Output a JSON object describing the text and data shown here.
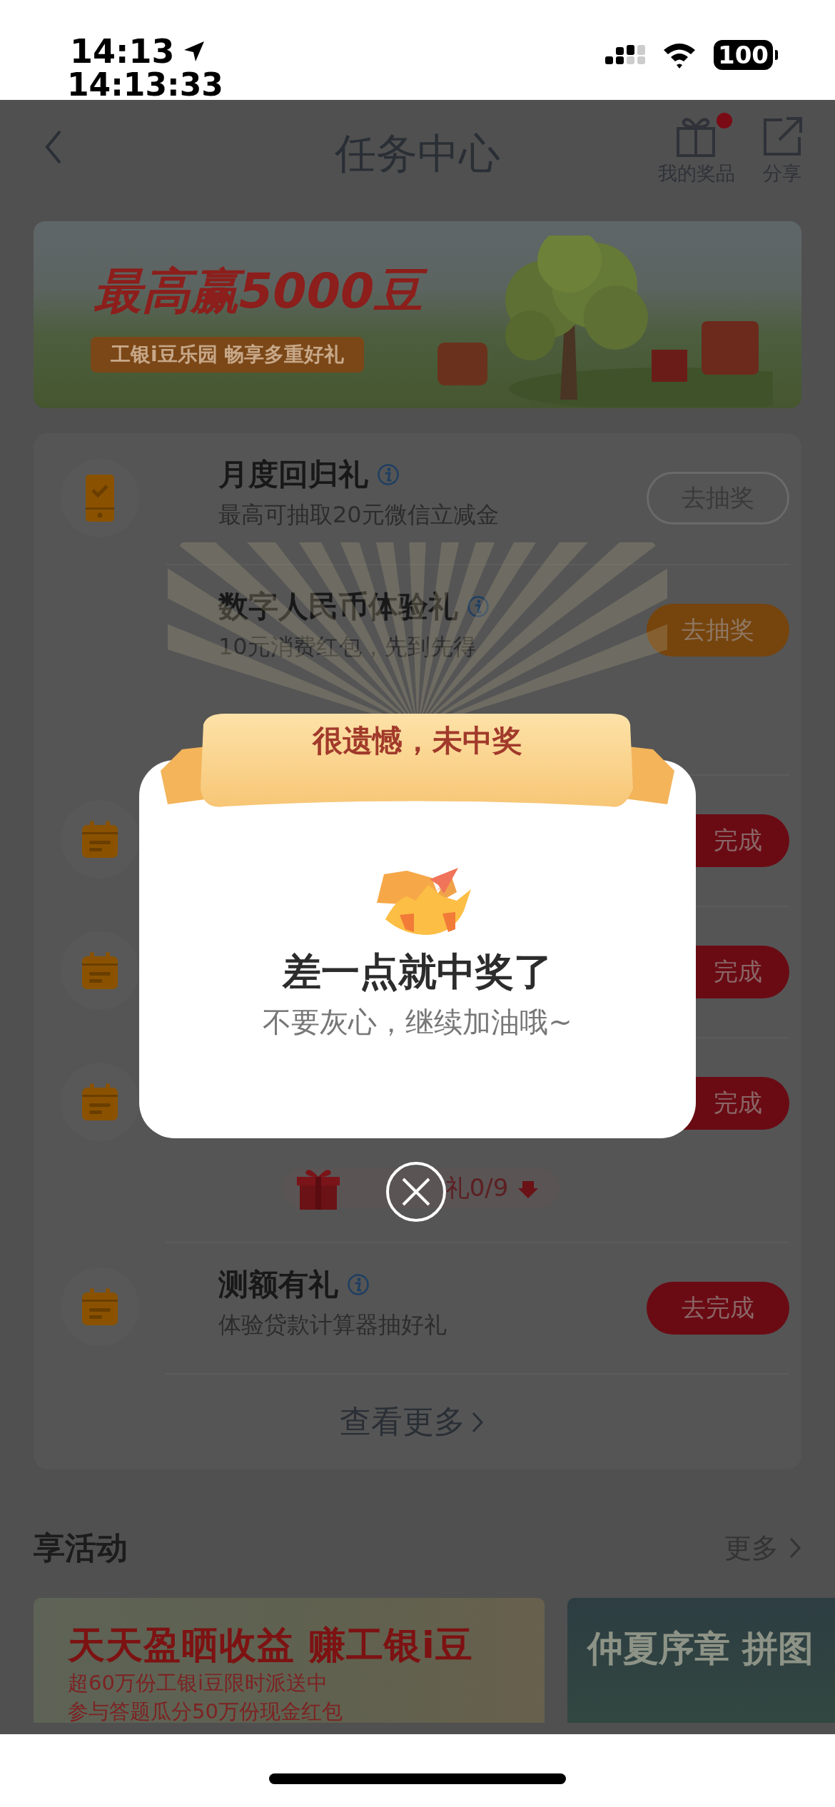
{
  "status_bar": {
    "time": "14:13",
    "time_seconds": "14:13:33",
    "battery": "100"
  },
  "nav": {
    "title": "任务中心",
    "actions": [
      {
        "kind": "gift",
        "label": "我的奖品",
        "badge": true
      },
      {
        "kind": "share",
        "label": "分享",
        "badge": false
      }
    ]
  },
  "banner": {
    "headline": "最高赢5000豆",
    "tagline": "工银i豆乐园 畅享多重好礼"
  },
  "tasks": [
    {
      "kind": "phone",
      "title": "月度回归礼",
      "subtitle": "最高可抽取20元微信立减金",
      "button": {
        "label": "去抽奖",
        "kind": "outline"
      }
    },
    {
      "kind": "none",
      "title": "数字人民币体验礼",
      "subtitle": "10元消费红包，先到先得",
      "button": {
        "label": "去抽奖",
        "kind": "orange"
      }
    },
    {
      "kind": "calendar",
      "button": {
        "label": "完成",
        "kind": "red"
      }
    },
    {
      "kind": "calendar",
      "button": {
        "label": "完成",
        "kind": "red"
      }
    },
    {
      "kind": "calendar",
      "button": {
        "label": "完成",
        "kind": "red"
      }
    }
  ],
  "nine_grid": {
    "label": "礼0/9"
  },
  "tasks_after": [
    {
      "kind": "calendar",
      "title": "测额有礼",
      "subtitle": "体验贷款计算器抽好礼",
      "button": {
        "label": "去完成",
        "kind": "red"
      }
    }
  ],
  "more_link": "查看更多",
  "activities": {
    "title": "享活动",
    "more": "更多",
    "items": [
      {
        "headline": "天天盈晒收益 赚工银i豆",
        "lines": [
          "超60万份工银i豆限时派送中",
          "参与答题瓜分50万份现金红包"
        ]
      },
      {
        "headline": "仲夏序章 拼图"
      }
    ]
  },
  "dialog": {
    "ribbon": "很遗憾，未中奖",
    "title": "差一点就中奖了",
    "message": "不要灰心，继续加油哦~"
  }
}
